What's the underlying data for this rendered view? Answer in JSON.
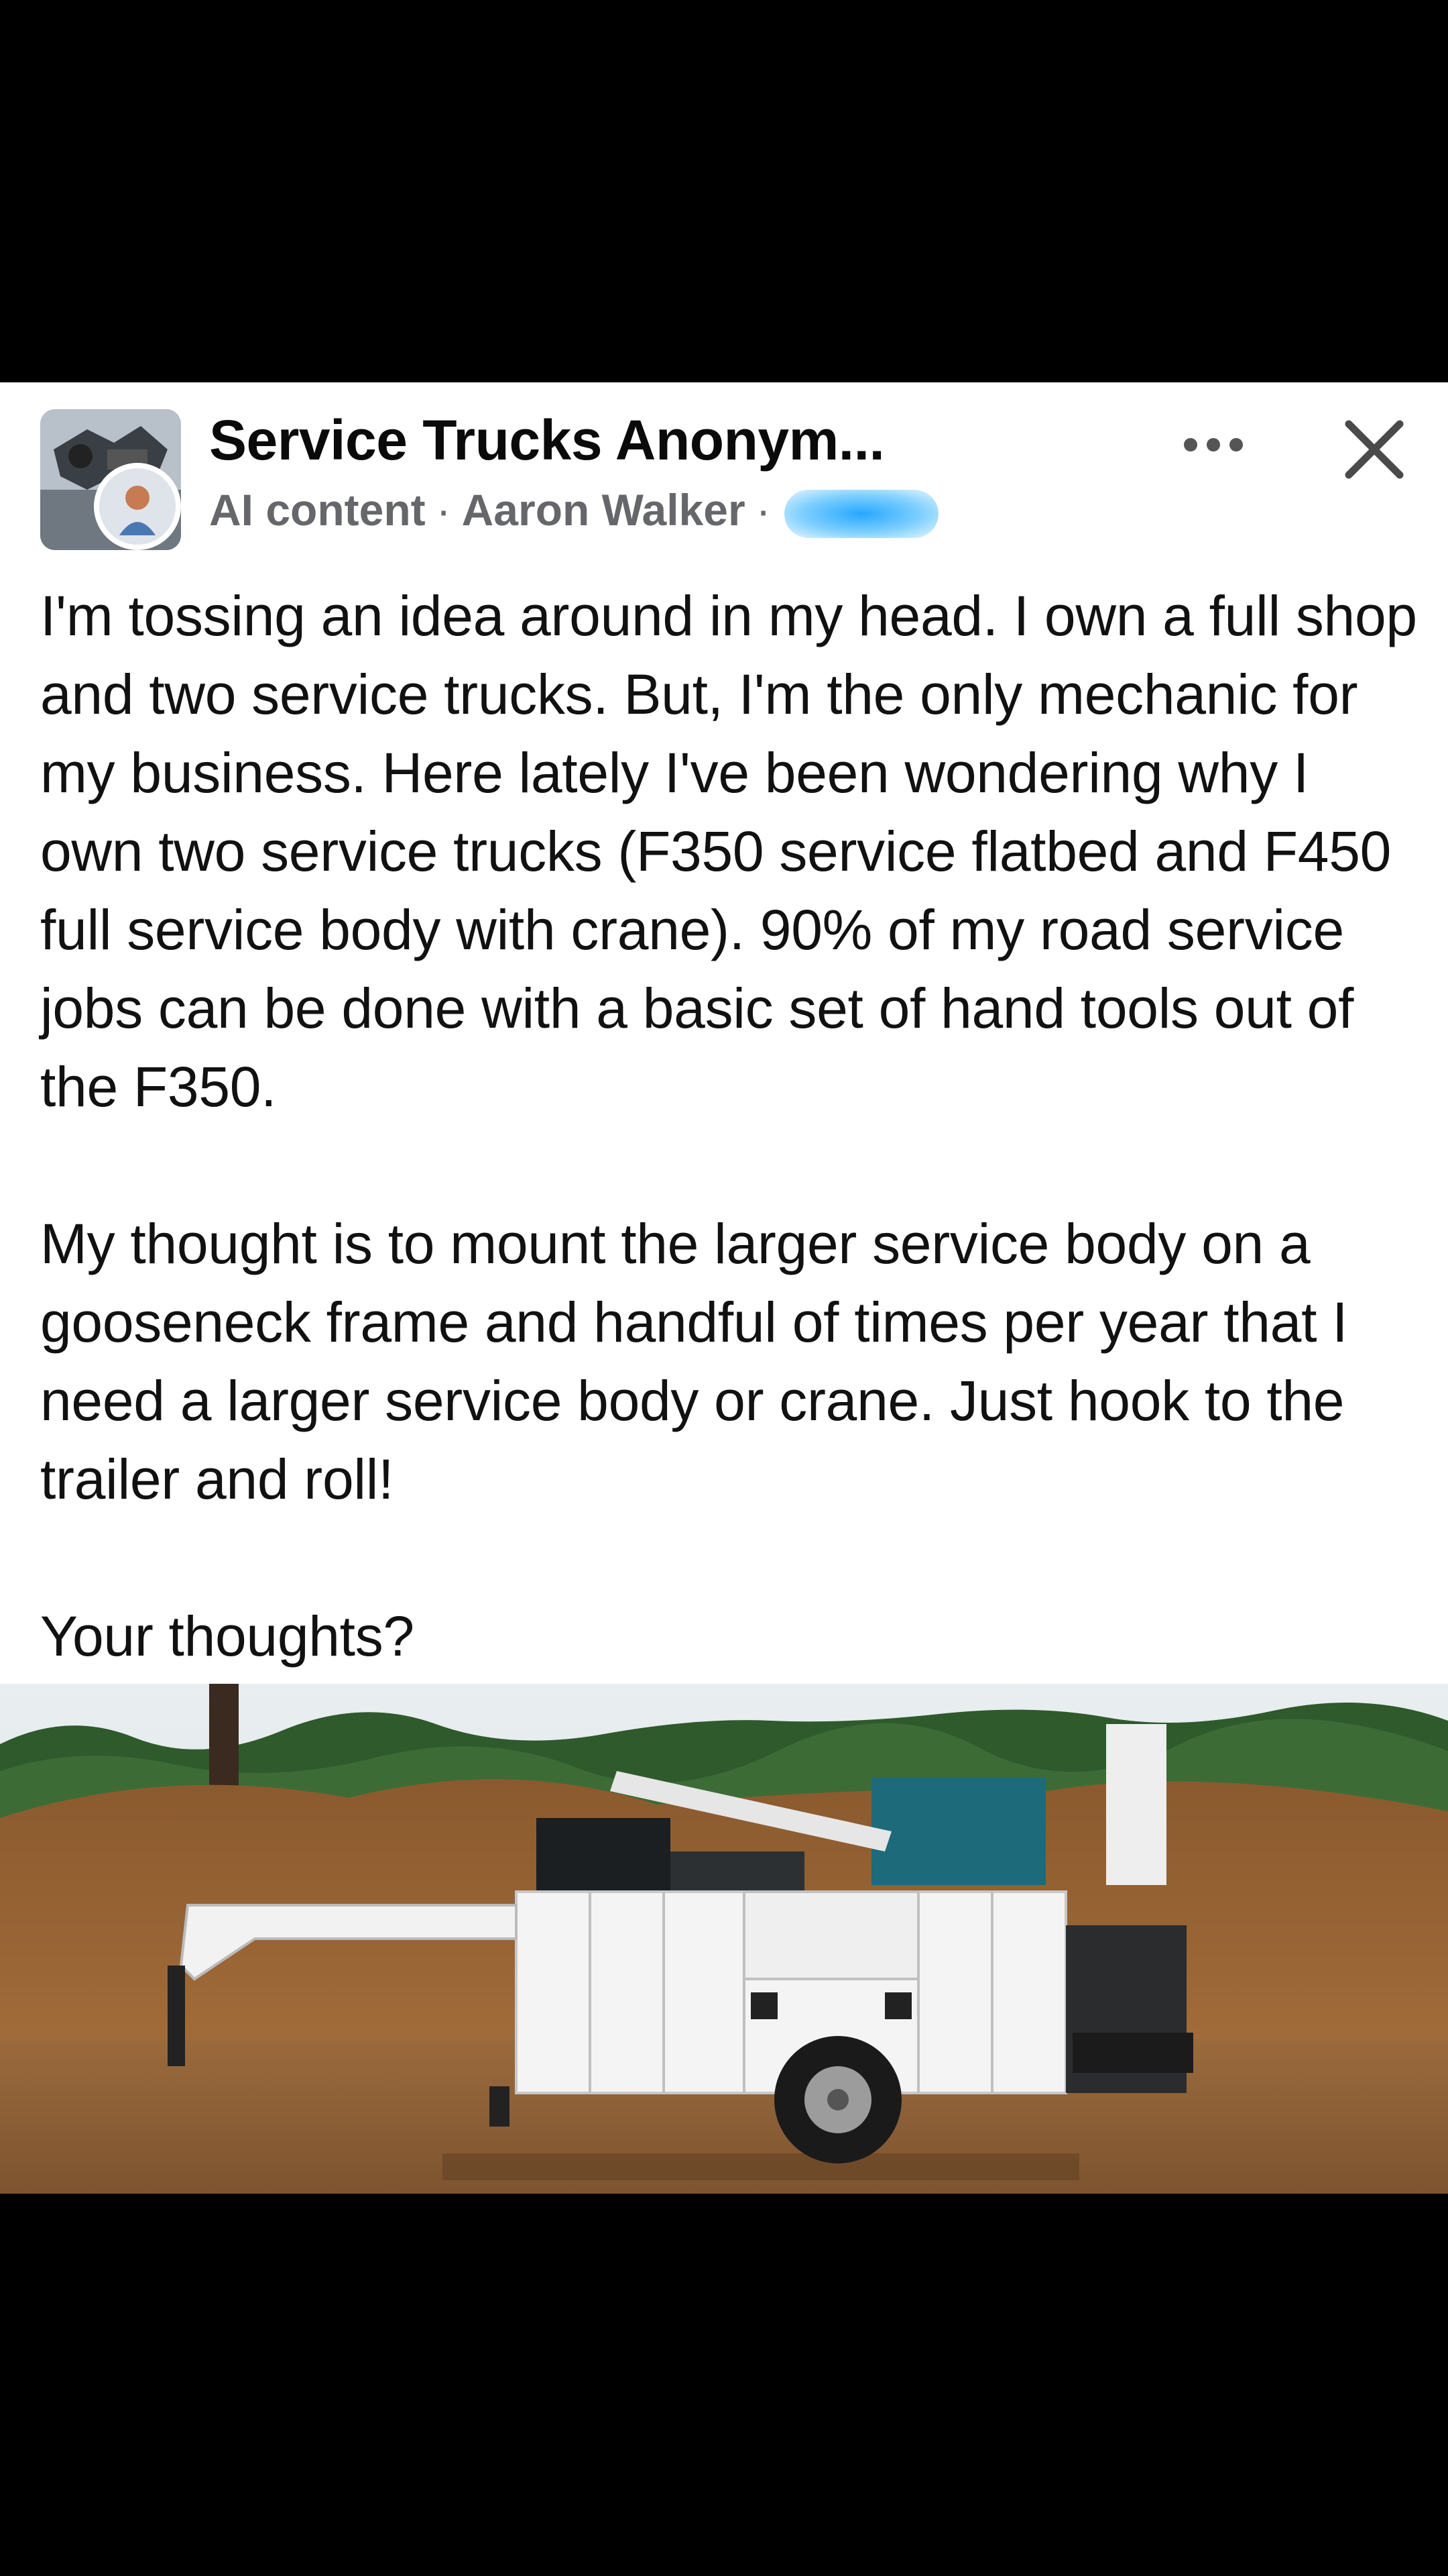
{
  "post": {
    "group_name": "Service Trucks Anonym...",
    "badge": "AI content",
    "author": "Aaron Walker",
    "separator": "·",
    "paragraphs": [
      "I'm tossing an idea around in my head. I own a full shop and two service trucks. But, I'm the only mechanic for my business. Here lately I've been wondering why I own two service trucks (F350 service flatbed and F450 full service body with crane). 90% of my road service jobs can be done with a basic set of hand tools out of the F350.",
      "My thought is to mount the larger service body on a gooseneck frame and handful of times per year that I need a larger service body or crane. Just hook to the trailer and roll!",
      "Your thoughts?"
    ]
  },
  "icons": {
    "more": "more-options-icon",
    "close": "close-icon"
  },
  "colors": {
    "text": "#111111",
    "meta": "#65676b",
    "background": "#ffffff",
    "redaction_blur": "#27a7ff"
  }
}
